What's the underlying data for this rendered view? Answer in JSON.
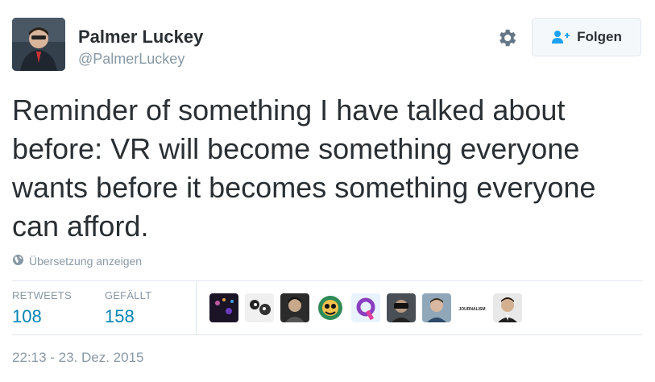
{
  "author": {
    "name": "Palmer Luckey",
    "handle": "@PalmerLuckey"
  },
  "actions": {
    "follow_label": "Folgen",
    "settings_icon": "gear-icon",
    "follow_icon": "add-user-icon"
  },
  "tweet": {
    "text": "Reminder of something I have talked about before: VR will become something everyone wants before it becomes something everyone can afford.",
    "translate_label": "Übersetzung anzeigen",
    "translate_icon": "globe-icon",
    "timestamp": "22:13 - 23. Dez. 2015"
  },
  "stats": {
    "retweets_label": "RETWEETS",
    "retweets_value": "108",
    "likes_label": "GEFÄLLT",
    "likes_value": "158"
  },
  "liker_avatars": {
    "count_shown": 9,
    "logo_text": "JOURNALISM"
  },
  "colors": {
    "text": "#292f33",
    "muted": "#8899a6",
    "link": "#0084b4",
    "border": "#e1e8ed",
    "button_bg": "#f5f8fa"
  }
}
